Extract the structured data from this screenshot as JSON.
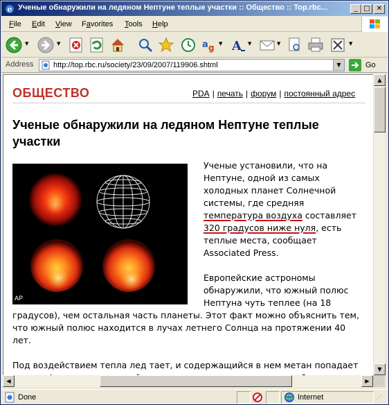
{
  "window": {
    "title": "Ученые обнаружили на ледяном Нептуне теплые участки :: Общество :: Top.rbc...",
    "min_glyph": "_",
    "max_glyph": "□",
    "close_glyph": "✕"
  },
  "menu": {
    "items": [
      {
        "label": "File",
        "accel": "F"
      },
      {
        "label": "Edit",
        "accel": "E"
      },
      {
        "label": "View",
        "accel": "V"
      },
      {
        "label": "Favorites",
        "accel": "a"
      },
      {
        "label": "Tools",
        "accel": "T"
      },
      {
        "label": "Help",
        "accel": "H"
      }
    ]
  },
  "toolbar": {
    "icons": [
      "back-icon",
      "forward-icon",
      "stop-icon",
      "refresh-icon",
      "home-icon",
      "search-icon",
      "favorites-icon",
      "history-icon",
      "encoding-icon",
      "font-size-icon",
      "mail-icon",
      "print-preview-icon",
      "print-icon",
      "edit-icon"
    ]
  },
  "address": {
    "label": "Address",
    "url": "http://top.rbc.ru/society/23/09/2007/119906.shtml",
    "go_label": "Go"
  },
  "page": {
    "section": "ОБЩЕСТВО",
    "links": [
      "PDA",
      "печать",
      "форум",
      "постоянный адрес"
    ],
    "separator": "|",
    "headline": "Ученые обнаружили на ледяном Нептуне теплые участки",
    "photo_credit": "AP",
    "p1_before": "Ученые установили, что на Нептуне, одной из самых холодных планет Солнечной системы, где средняя ",
    "p1_hl1": "температура воздуха",
    "p1_mid": " составляет ",
    "p1_hl2": "320 градусов ниже нуля",
    "p1_after": ", есть теплые места, сообщает Associated Press.",
    "p2": "Европейские астрономы обнаружили, что южный полюс Нептуна чуть теплее (на 18 градусов), чем остальная часть планеты. Этот факт можно объяснить тем, что южный полюс находится в лучах летнего Солнца на протяжении 40 лет.",
    "p3": "Под воздействием тепла лед тает, и содержащийся в нем метан попадает в атмосферу, поэтому в ней над южным полюсом этого газа в 2 раза больше, чем в других частях планеты. Реже уходя на него"
  },
  "status": {
    "text": "Done",
    "zone": "Internet"
  },
  "colors": {
    "section": "#c0302a",
    "highlight_underline": "#d01010",
    "titlebar_start": "#0a246a",
    "titlebar_end": "#a6caf0"
  }
}
